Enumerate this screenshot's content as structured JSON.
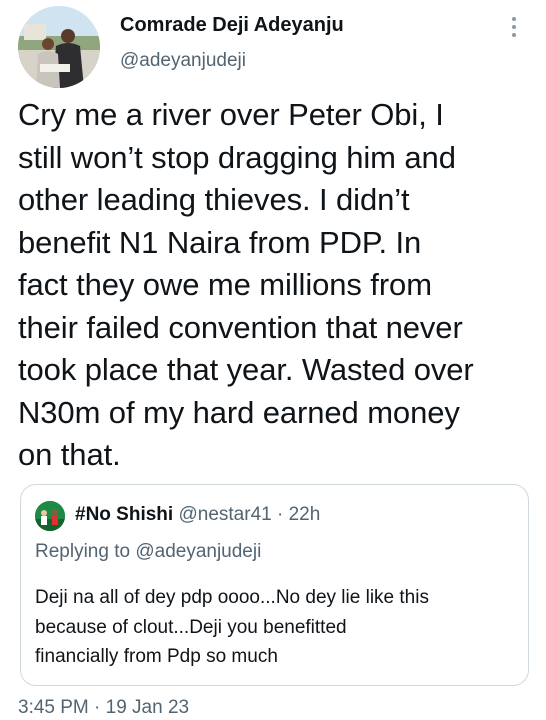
{
  "author": {
    "name": "Comrade Deji Adeyanju",
    "handle": "@adeyanjudeji"
  },
  "tweet": {
    "text": "Cry me a river over Peter Obi, I\nstill won’t stop dragging him and\nother leading thieves. I didn’t\nbenefit N1 Naira from PDP. In\nfact they owe me millions from\ntheir failed convention that never\ntook place that year. Wasted over\nN30m of my hard earned money\non that."
  },
  "quote": {
    "name": "#No Shishi",
    "handle_time": "@nestar41 · 22h",
    "replying": "Replying to @adeyanjudeji",
    "text": "Deji na all of dey pdp oooo...No dey lie like this\nbecause of clout...Deji you benefitted\nfinancially from Pdp so much"
  },
  "timestamp": "3:45 PM · 19 Jan 23",
  "icons": {
    "more": "more-vertical-icon"
  }
}
